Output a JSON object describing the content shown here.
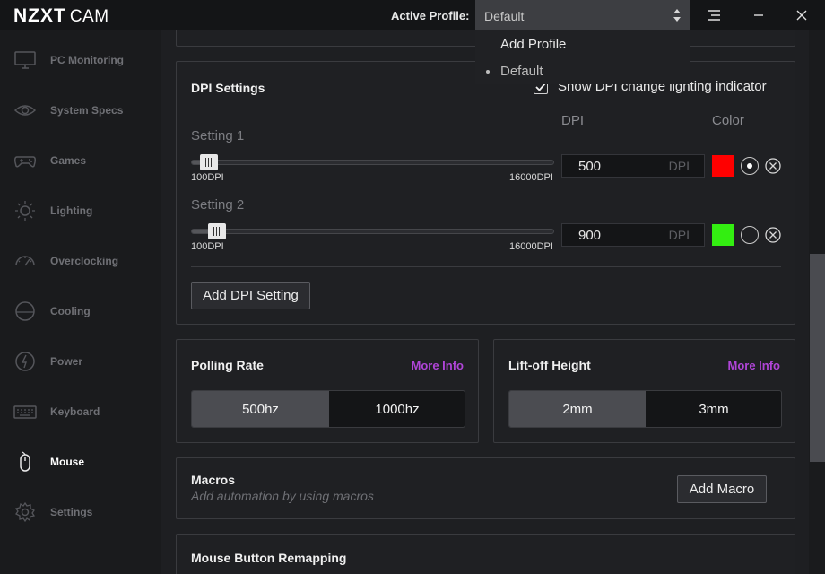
{
  "app": {
    "logo_bold": "NZXT",
    "logo_light": "CAM"
  },
  "header": {
    "active_profile_label": "Active Profile:",
    "profile_value": "Default",
    "dropdown": {
      "add_profile": "Add Profile",
      "items": [
        "Default"
      ]
    }
  },
  "sidebar": {
    "items": [
      {
        "label": "PC Monitoring",
        "icon": "monitor-icon"
      },
      {
        "label": "System Specs",
        "icon": "eye-icon"
      },
      {
        "label": "Games",
        "icon": "gamepad-icon"
      },
      {
        "label": "Lighting",
        "icon": "sun-icon"
      },
      {
        "label": "Overclocking",
        "icon": "gauge-icon"
      },
      {
        "label": "Cooling",
        "icon": "fan-icon"
      },
      {
        "label": "Power",
        "icon": "power-icon"
      },
      {
        "label": "Keyboard",
        "icon": "keyboard-icon"
      },
      {
        "label": "Mouse",
        "icon": "mouse-icon",
        "active": true
      },
      {
        "label": "Settings",
        "icon": "gear-icon"
      }
    ]
  },
  "dpi": {
    "title": "DPI Settings",
    "show_indicator_label": "Show DPI change lighting indicator",
    "show_indicator_checked": true,
    "col_dpi": "DPI",
    "col_color": "Color",
    "min_label": "100DPI",
    "max_label": "16000DPI",
    "min_value": 100,
    "max_value": 16000,
    "unit": "DPI",
    "settings": [
      {
        "label": "Setting 1",
        "value": "500",
        "color": "#ff0000",
        "selected": true
      },
      {
        "label": "Setting 2",
        "value": "900",
        "color": "#33ee11",
        "selected": false
      }
    ],
    "add_button": "Add DPI Setting"
  },
  "polling": {
    "title": "Polling Rate",
    "more_info": "More Info",
    "options": [
      "500hz",
      "1000hz"
    ],
    "selected": "500hz"
  },
  "liftoff": {
    "title": "Lift-off Height",
    "more_info": "More Info",
    "options": [
      "2mm",
      "3mm"
    ],
    "selected": "2mm"
  },
  "macros": {
    "title": "Macros",
    "subtitle": "Add automation by using macros",
    "add_button": "Add Macro"
  },
  "remap": {
    "title": "Mouse Button Remapping"
  },
  "colors": {
    "accent_link": "#b045d8",
    "background": "#1e1f22",
    "sidebar": "#1a1b1d"
  }
}
